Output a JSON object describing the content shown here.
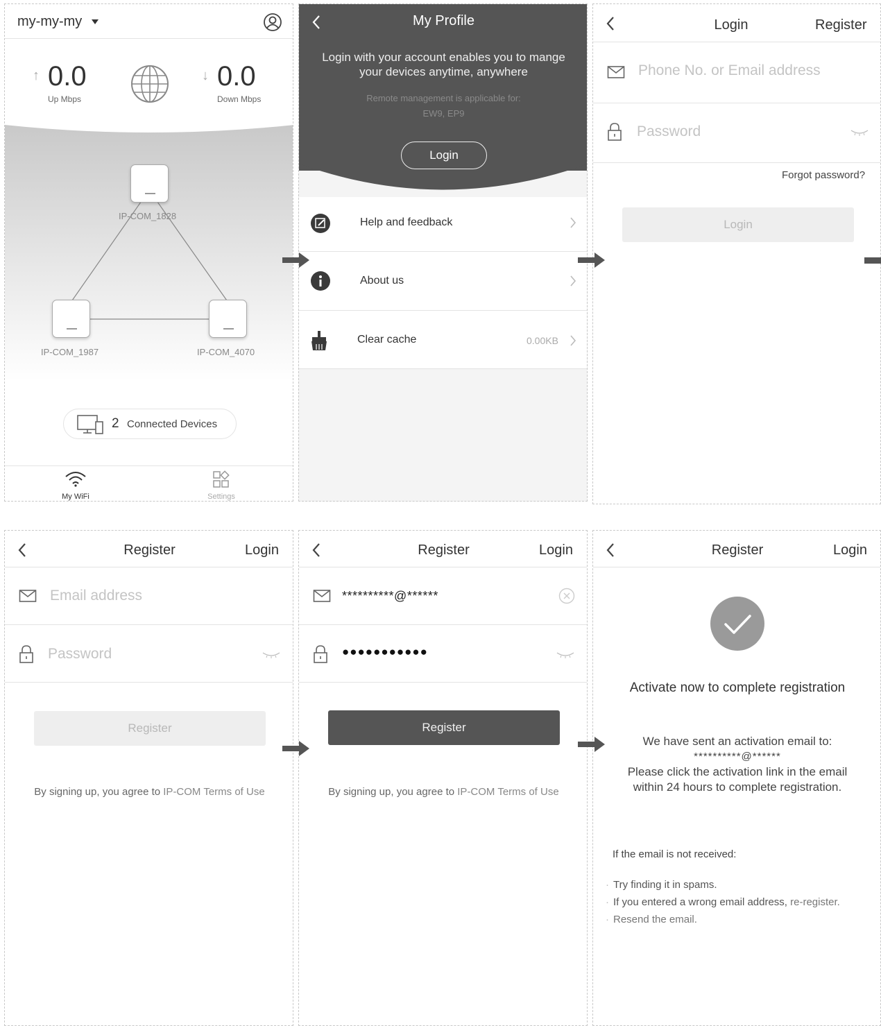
{
  "home": {
    "network_name": "my-my-my",
    "up_value": "0.0",
    "up_label": "Up Mbps",
    "down_value": "0.0",
    "down_label": "Down Mbps",
    "nodes": [
      "IP-COM_1828",
      "IP-COM_1987",
      "IP-COM_4070"
    ],
    "connected_count": "2",
    "connected_label": "Connected Devices",
    "tabs": [
      "My WiFi",
      "Settings"
    ]
  },
  "profile": {
    "title": "My Profile",
    "intro_line1": "Login with your account enables you to mange",
    "intro_line2": "your devices anytime, anywhere",
    "remote_line1": "Remote management is applicable for:",
    "remote_line2": "EW9, EP9",
    "login_button": "Login",
    "menu": [
      {
        "label": "Help and feedback",
        "value": ""
      },
      {
        "label": "About us",
        "value": ""
      },
      {
        "label": "Clear cache",
        "value": "0.00KB"
      }
    ]
  },
  "login_screen": {
    "title": "Login",
    "switch_link": "Register",
    "account_placeholder": "Phone No. or Email address",
    "password_placeholder": "Password",
    "forgot": "Forgot password?",
    "login_button": "Login"
  },
  "register_empty": {
    "title": "Register",
    "switch_link": "Login",
    "email_placeholder": "Email address",
    "password_placeholder": "Password",
    "register_button": "Register",
    "terms_prefix": "By signing up, you agree to ",
    "terms_link": "IP-COM Terms of Use"
  },
  "register_filled": {
    "title": "Register",
    "switch_link": "Login",
    "email_value": "**********@******",
    "password_value": "●●●●●●●●●●●",
    "register_button": "Register",
    "terms_prefix": "By signing up, you agree to ",
    "terms_link": "IP-COM Terms of Use"
  },
  "activation": {
    "title": "Register",
    "switch_link": "Login",
    "heading": "Activate now to complete registration",
    "sent_line": "We have sent an activation email to:",
    "email_masked": "**********@******",
    "instruction_line1": "Please click the activation link in the email",
    "instruction_line2": "within 24 hours to complete registration.",
    "not_received": "If the email is not received:",
    "tip1": "Try finding it in spams.",
    "tip2_prefix": "If you entered a wrong email address, ",
    "tip2_link": "re-register.",
    "tip3": "Resend the email."
  },
  "colors": {
    "dark_header": "#555555",
    "disabled_button": "#eeeeee",
    "check_circle": "#9a9a9a"
  }
}
